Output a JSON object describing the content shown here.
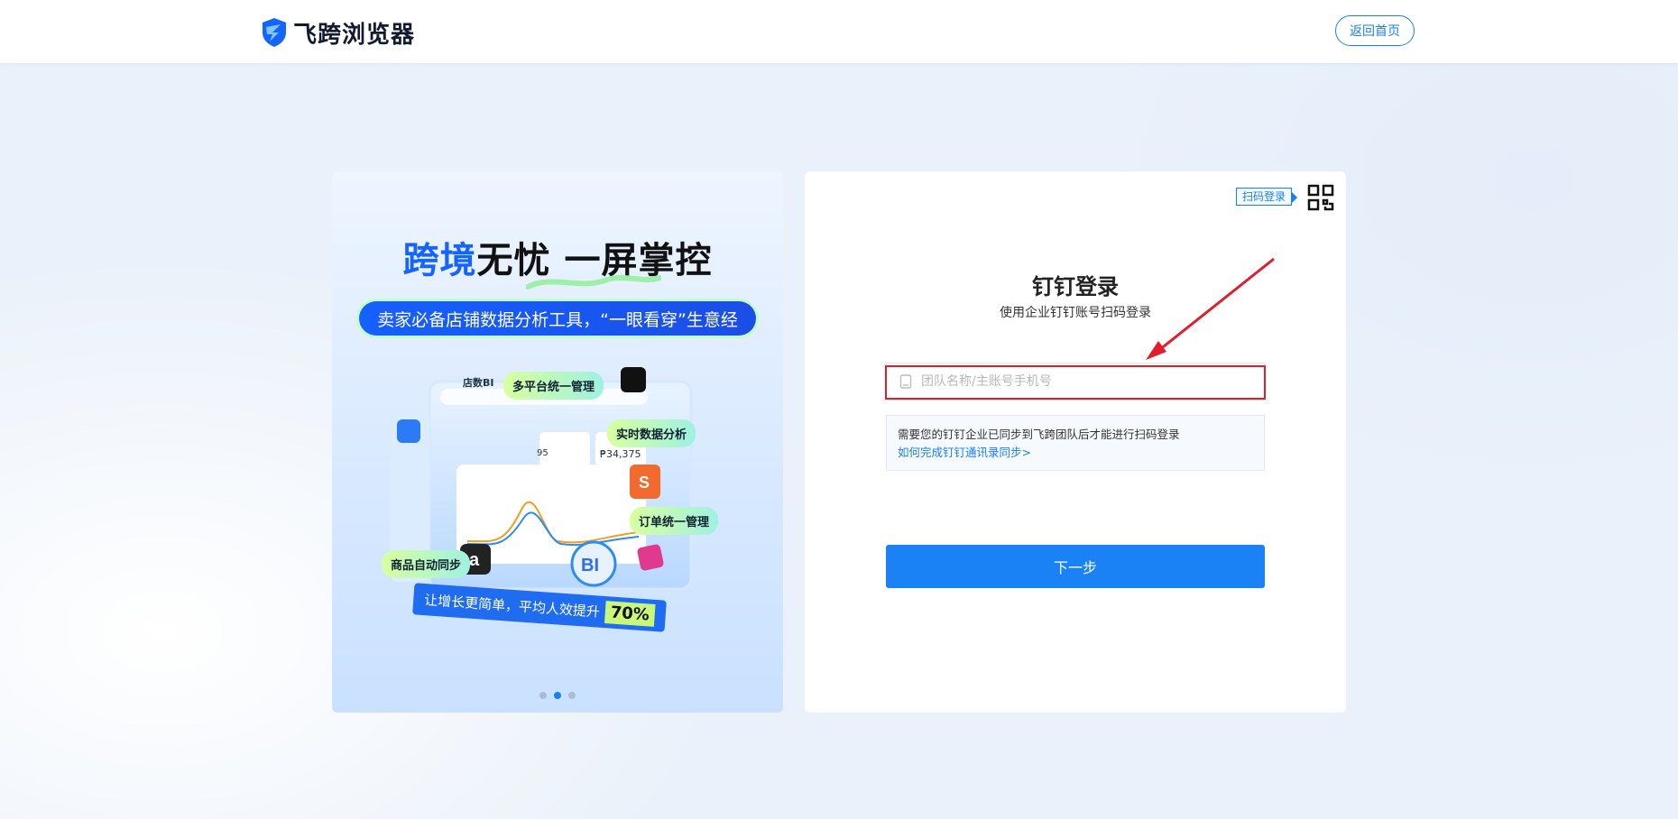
{
  "header": {
    "brand": "飞跨浏览器",
    "home_button": "返回首页"
  },
  "banner": {
    "headline_blue": "跨境",
    "headline_rest": "无忧 一屏掌控",
    "pill_text": "卖家必备店铺数据分析工具，“一眼看穿”生意经",
    "dashboard_title": "店数BI",
    "tags": [
      "多平台统一管理",
      "实时数据分析",
      "订单统一管理",
      "商品自动同步"
    ],
    "promo_text": "让增长更简单，平均人效提升",
    "promo_value": "70%",
    "stats": [
      "95",
      "₱34,375"
    ],
    "slides": 3,
    "active_slide": 1
  },
  "login": {
    "qr_label": "扫码登录",
    "title": "钉钉登录",
    "subtitle": "使用企业钉钉账号扫码登录",
    "input_placeholder": "团队名称/主账号手机号",
    "input_value": "",
    "note_text": "需要您的钉钉企业已同步到飞跨团队后才能进行扫码登录",
    "note_link": "如何完成钉钉通讯录同步>",
    "next_button": "下一步"
  },
  "colors": {
    "accent": "#1a82f5",
    "highlight": "#e21d2c",
    "banner_blue": "#1664ff"
  }
}
